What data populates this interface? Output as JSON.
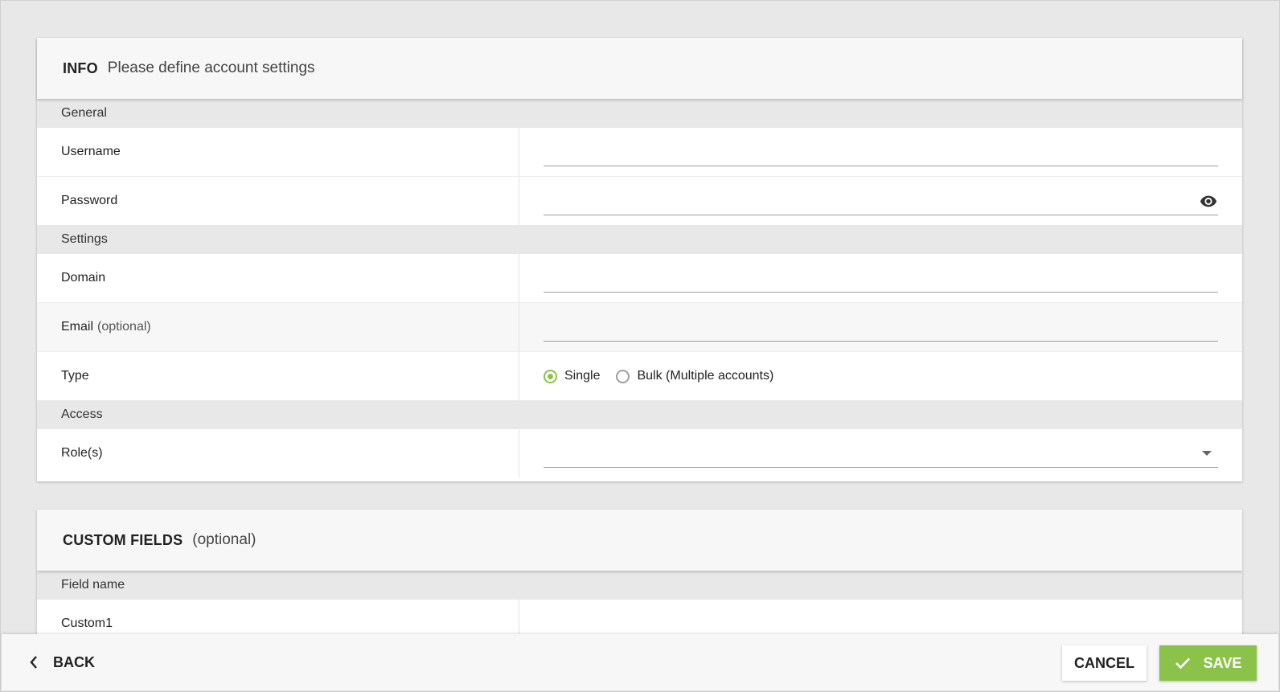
{
  "info_card": {
    "title": "INFO",
    "subtitle": "Please define account settings",
    "sections": {
      "general": "General",
      "settings": "Settings",
      "access": "Access"
    },
    "fields": {
      "username": {
        "label": "Username",
        "value": ""
      },
      "password": {
        "label": "Password",
        "value": ""
      },
      "domain": {
        "label": "Domain",
        "value": ""
      },
      "email": {
        "label": "Email",
        "optional": "(optional)",
        "value": ""
      },
      "type": {
        "label": "Type",
        "options": [
          "Single",
          "Bulk (Multiple accounts)"
        ],
        "selected": "Single"
      },
      "roles": {
        "label": "Role(s)",
        "value": ""
      }
    }
  },
  "custom_card": {
    "title": "CUSTOM FIELDS",
    "subtitle": "(optional)",
    "section": "Field name",
    "fields": [
      {
        "label": "Custom1",
        "value": ""
      }
    ]
  },
  "footer": {
    "back_label": "BACK",
    "cancel_label": "CANCEL",
    "save_label": "SAVE"
  },
  "colors": {
    "accent": "#8bc34a",
    "background": "#e8e8e8",
    "header": "#f7f7f7"
  },
  "icons": {
    "password_toggle": "eye-icon",
    "roles_dropdown": "dropdown-arrow-icon",
    "back": "chevron-left-icon",
    "save": "check-icon"
  }
}
